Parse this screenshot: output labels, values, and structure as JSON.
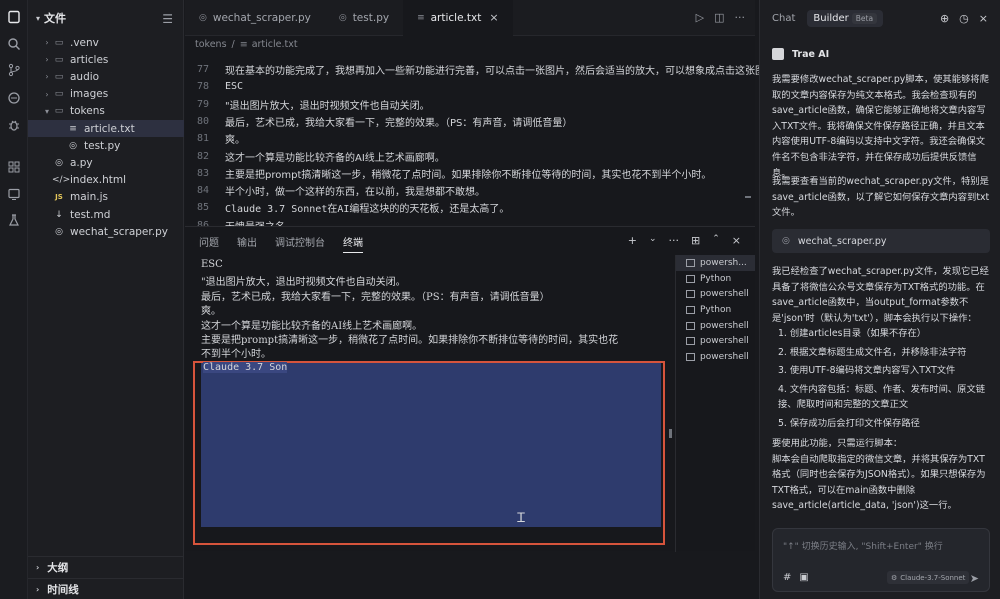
{
  "activity_icons": [
    "files-icon",
    "search-icon",
    "source-control-icon",
    "extensions-icon",
    "debug-icon",
    "apps-icon",
    "remote-icon",
    "flask-icon"
  ],
  "explorer": {
    "title": "文件",
    "items": [
      {
        "label": ".venv",
        "type": "folder",
        "open": false
      },
      {
        "label": "articles",
        "type": "folder",
        "open": false
      },
      {
        "label": "audio",
        "type": "folder",
        "open": false
      },
      {
        "label": "images",
        "type": "folder",
        "open": false
      },
      {
        "label": "tokens",
        "type": "folder",
        "open": true
      },
      {
        "label": "article.txt",
        "type": "file",
        "icon": "≡",
        "selected": true
      },
      {
        "label": "test.py",
        "type": "file",
        "icon": "◎"
      },
      {
        "label": "a.py",
        "type": "file",
        "icon": "◎"
      },
      {
        "label": "index.html",
        "type": "file",
        "icon": "</>"
      },
      {
        "label": "main.js",
        "type": "file",
        "icon": "JS"
      },
      {
        "label": "test.md",
        "type": "file",
        "icon": "↓"
      },
      {
        "label": "wechat_scraper.py",
        "type": "file",
        "icon": "◎"
      }
    ],
    "outline": "大纲",
    "timeline": "时间线"
  },
  "editor": {
    "tabs": [
      {
        "label": "wechat_scraper.py",
        "active": false
      },
      {
        "label": "test.py",
        "active": false
      },
      {
        "label": "article.txt",
        "active": true
      }
    ],
    "breadcrumb": [
      "tokens",
      "article.txt"
    ],
    "lines": [
      {
        "n": "77",
        "t": "现在基本的功能完成了，我想再加入一些新功能进行完善，可以点击一张图片，然后会适当的放大，可以想象成点击这张图片后"
      },
      {
        "n": "78",
        "t": "ESC"
      },
      {
        "n": "79",
        "t": "\"退出图片放大，退出时视频文件也自动关闭。"
      },
      {
        "n": "80",
        "t": "最后，艺术已成，我给大家看一下，完整的效果。（PS：有声音，请调低音量）"
      },
      {
        "n": "81",
        "t": "爽。"
      },
      {
        "n": "82",
        "t": "这才一个算是功能比较齐备的AI线上艺术画廊啊。"
      },
      {
        "n": "83",
        "t": "主要是把prompt搞清晰这一步，稍微花了点时间。如果排除你不断排位等待的时间，其实也花不到半个小时。"
      },
      {
        "n": "84",
        "t": "半个小时，做一个这样的东西，在以前，我是想都不敢想。"
      },
      {
        "n": "85",
        "t": "Claude 3.7 Sonnet在AI编程这块的的天花板，还是太高了。"
      },
      {
        "n": "86",
        "t": "无愧最强之名。"
      }
    ]
  },
  "panel": {
    "tabs": [
      "问题",
      "输出",
      "调试控制台",
      "终端"
    ],
    "active_tab": "终端",
    "terminal_lines": [
      "ESC",
      "\"退出图片放大，退出时视频文件也自动关闭。",
      "最后，艺术已成，我给大家看一下，完整的效果。（PS：有声音，请调低音量）",
      "爽。",
      "这才一个算是功能比较齐备的AI线上艺术画廊啊。",
      "主要是把prompt搞清晰这一步，稍微花了点时间。如果排除你不断排位等待的时间，其实也花",
      "不到半个小时。",
      "半个小时，做一个这样的东西，在以前，我是想都不敢想。"
    ],
    "selected_text": "Claude 3.7 Son",
    "sessions": [
      "powersh...",
      "Python",
      "powershell",
      "Python",
      "powershell",
      "powershell",
      "powershell"
    ]
  },
  "chat": {
    "tabs": [
      "Chat",
      "Builder"
    ],
    "active_tab": "Builder",
    "beta_label": "Beta",
    "author": "Trae AI",
    "para1": "我需要修改wechat_scraper.py脚本，使其能够将爬取的文章内容保存为纯文本格式。我会检查现有的save_article函数，确保它能够正确地将文章内容写入TXT文件。我将确保文件保存路径正确，并且文本内容使用UTF-8编码以支持中文字符。我还会确保文件名不包含非法字符，并在保存成功后提供反馈信息。",
    "para2": "我需要查看当前的wechat_scraper.py文件，特别是save_article函数，以了解它如何保存文章内容到txt文件。",
    "file_chip": "wechat_scraper.py",
    "para3": "我已经检查了wechat_scraper.py文件，发现它已经具备了将微信公众号文章保存为TXT格式的功能。在save_article函数中，当output_format参数不是'json'时（默认为'txt'），脚本会执行以下操作：",
    "steps": [
      "1. 创建articles目录（如果不存在）",
      "2. 根据文章标题生成文件名，并移除非法字符",
      "3. 使用UTF-8编码将文章内容写入TXT文件",
      "4. 文件内容包括：标题、作者、发布时间、原文链接、爬取时间和完整的文章正文",
      "5. 保存成功后会打印文件保存路径"
    ],
    "para4": "要使用此功能，只需运行脚本：\n脚本会自动爬取指定的微信文章，并将其保存为TXT格式（同时也会保存为JSON格式）。如果只想保存为TXT格式，可以在main函数中删除save_article(article_data, 'json')这一行。",
    "input_placeholder": "\"↑\" 切换历史输入, \"Shift+Enter\" 换行",
    "model": "Claude-3.7-Sonnet"
  }
}
